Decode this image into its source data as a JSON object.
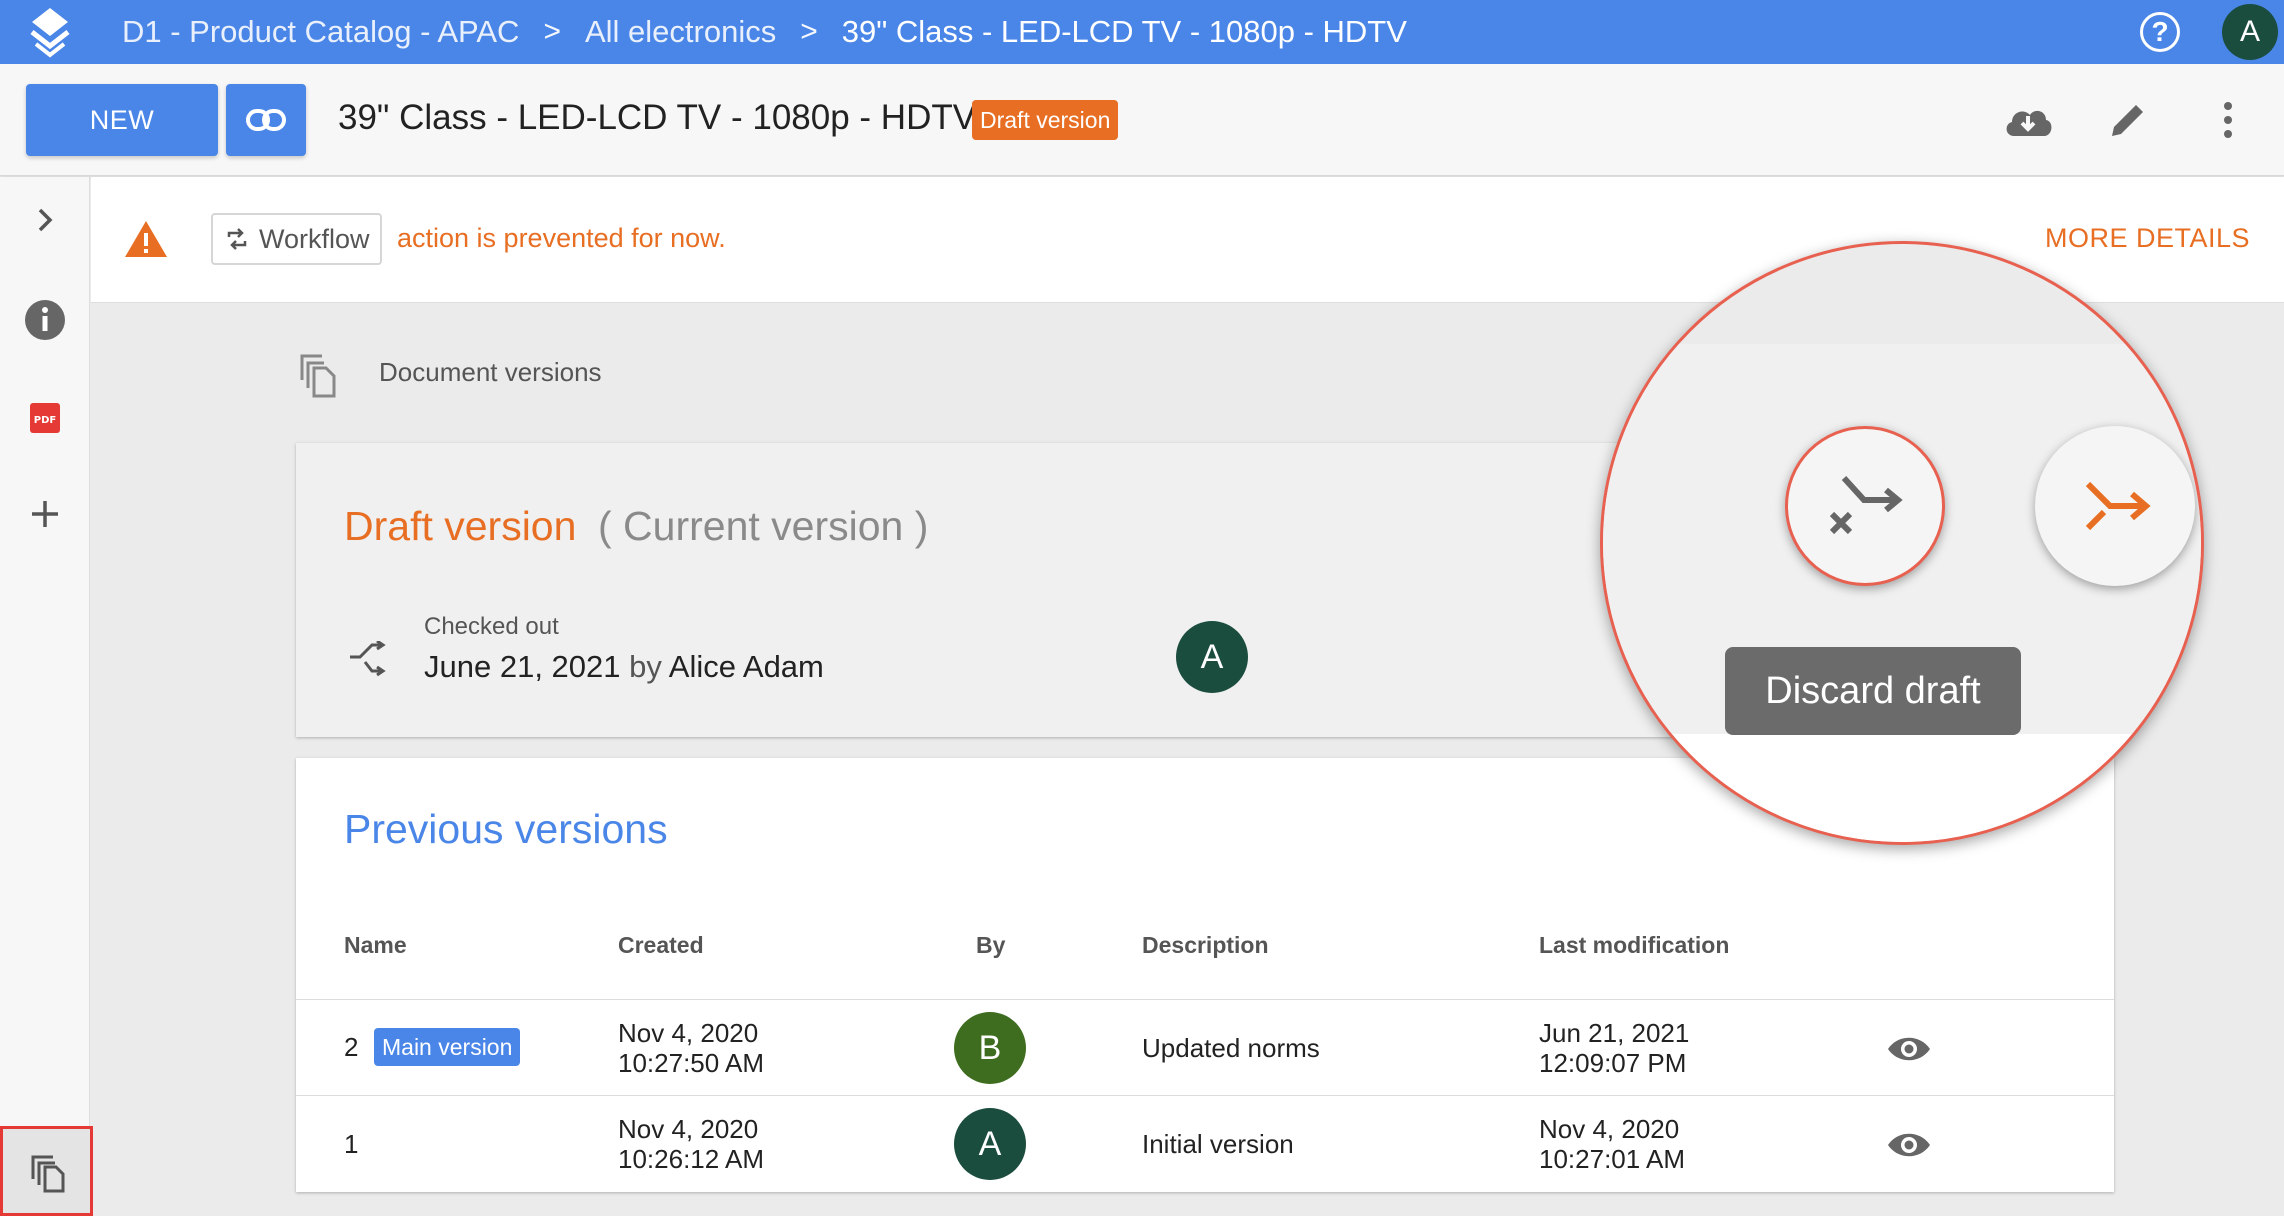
{
  "breadcrumb": {
    "items": [
      "D1 - Product Catalog - APAC",
      "All electronics",
      "39\" Class - LED-LCD TV - 1080p - HDTV"
    ],
    "separator": ">"
  },
  "topbar": {
    "help_label": "?",
    "user_initial": "A"
  },
  "header": {
    "new_label": "NEW",
    "title": "39\" Class - LED-LCD TV - 1080p - HDTV",
    "badge": "Draft version"
  },
  "warning": {
    "chip_label": "Workflow",
    "message": "action is prevented for now.",
    "more_details": "MORE DETAILS"
  },
  "section": {
    "title": "Document versions"
  },
  "draft": {
    "title": "Draft version",
    "subtitle": "( Current version )",
    "checked_out_label": "Checked out",
    "date": "June 21, 2021",
    "by_word": "by",
    "user": "Alice Adam",
    "user_initial": "A"
  },
  "previous": {
    "title": "Previous versions",
    "columns": [
      "Name",
      "Created",
      "By",
      "Description",
      "Last modification"
    ],
    "rows": [
      {
        "name": "2",
        "badge": "Main version",
        "created_date": "Nov 4, 2020",
        "created_time": "10:27:50 AM",
        "by_initial": "B",
        "by_color": "#3e6d1f",
        "description": "Updated norms",
        "modified_date": "Jun 21, 2021",
        "modified_time": "12:09:07 PM"
      },
      {
        "name": "1",
        "badge": "",
        "created_date": "Nov 4, 2020",
        "created_time": "10:26:12 AM",
        "by_initial": "A",
        "by_color": "#1b4d3e",
        "description": "Initial version",
        "modified_date": "Nov 4, 2020",
        "modified_time": "10:27:01 AM"
      }
    ]
  },
  "callout": {
    "tooltip": "Discard draft"
  },
  "colors": {
    "accent": "#4a86e8",
    "warning": "#e76e22",
    "highlight": "#e8604f"
  },
  "icons": {
    "actions": [
      "download-cloud-icon",
      "edit-pencil-icon",
      "more-vert-icon"
    ],
    "sidebar": [
      "chevron-right-icon",
      "info-icon",
      "pdf-icon",
      "plus-icon",
      "versions-icon"
    ]
  }
}
